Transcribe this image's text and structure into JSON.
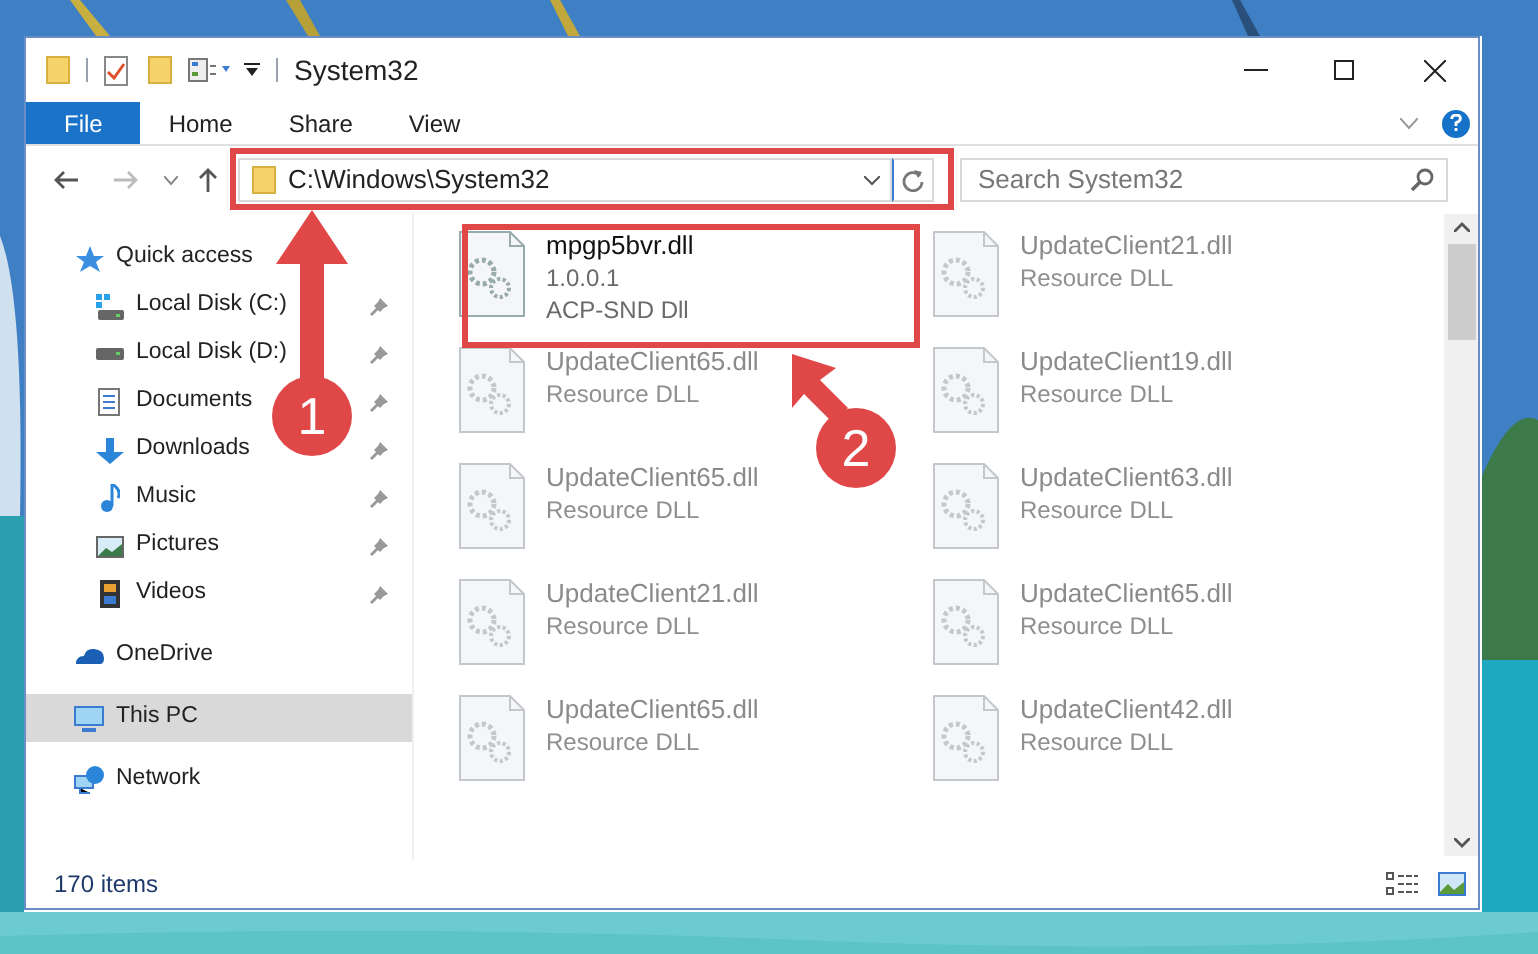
{
  "window": {
    "title": "System32"
  },
  "ribbon": {
    "tabs": [
      {
        "label": "File",
        "selected": true
      },
      {
        "label": "Home",
        "selected": false
      },
      {
        "label": "Share",
        "selected": false
      },
      {
        "label": "View",
        "selected": false
      }
    ]
  },
  "address_bar": {
    "path": "C:\\Windows\\System32"
  },
  "search": {
    "placeholder": "Search System32"
  },
  "sidebar": {
    "items": [
      {
        "label": "Quick access",
        "selected": false,
        "children": [
          {
            "label": "Local Disk (C:)",
            "pinned": true
          },
          {
            "label": "Local Disk (D:)",
            "pinned": true
          },
          {
            "label": "Documents",
            "pinned": true
          },
          {
            "label": "Downloads",
            "pinned": true
          },
          {
            "label": "Music",
            "pinned": true
          },
          {
            "label": "Pictures",
            "pinned": true
          },
          {
            "label": "Videos",
            "pinned": true
          }
        ]
      },
      {
        "label": "OneDrive",
        "selected": false
      },
      {
        "label": "This PC",
        "selected": true
      },
      {
        "label": "Network",
        "selected": false
      }
    ]
  },
  "files": [
    {
      "name": "mpgp5bvr.dll",
      "details": [
        "1.0.0.1",
        "ACP-SND Dll"
      ],
      "dimmed": false
    },
    {
      "name": "UpdateClient21.dll",
      "details": [
        "Resource DLL"
      ],
      "dimmed": true
    },
    {
      "name": "UpdateClient65.dll",
      "details": [
        "Resource DLL"
      ],
      "dimmed": true
    },
    {
      "name": "UpdateClient19.dll",
      "details": [
        "Resource DLL"
      ],
      "dimmed": true
    },
    {
      "name": "UpdateClient65.dll",
      "details": [
        "Resource DLL"
      ],
      "dimmed": true
    },
    {
      "name": "UpdateClient63.dll",
      "details": [
        "Resource DLL"
      ],
      "dimmed": true
    },
    {
      "name": "UpdateClient21.dll",
      "details": [
        "Resource DLL"
      ],
      "dimmed": true
    },
    {
      "name": "UpdateClient65.dll",
      "details": [
        "Resource DLL"
      ],
      "dimmed": true
    },
    {
      "name": "UpdateClient65.dll",
      "details": [
        "Resource DLL"
      ],
      "dimmed": true
    },
    {
      "name": "UpdateClient42.dll",
      "details": [
        "Resource DLL"
      ],
      "dimmed": true
    }
  ],
  "status_bar": {
    "item_count": "170 items"
  },
  "annotations": [
    {
      "label": "1"
    },
    {
      "label": "2"
    }
  ]
}
